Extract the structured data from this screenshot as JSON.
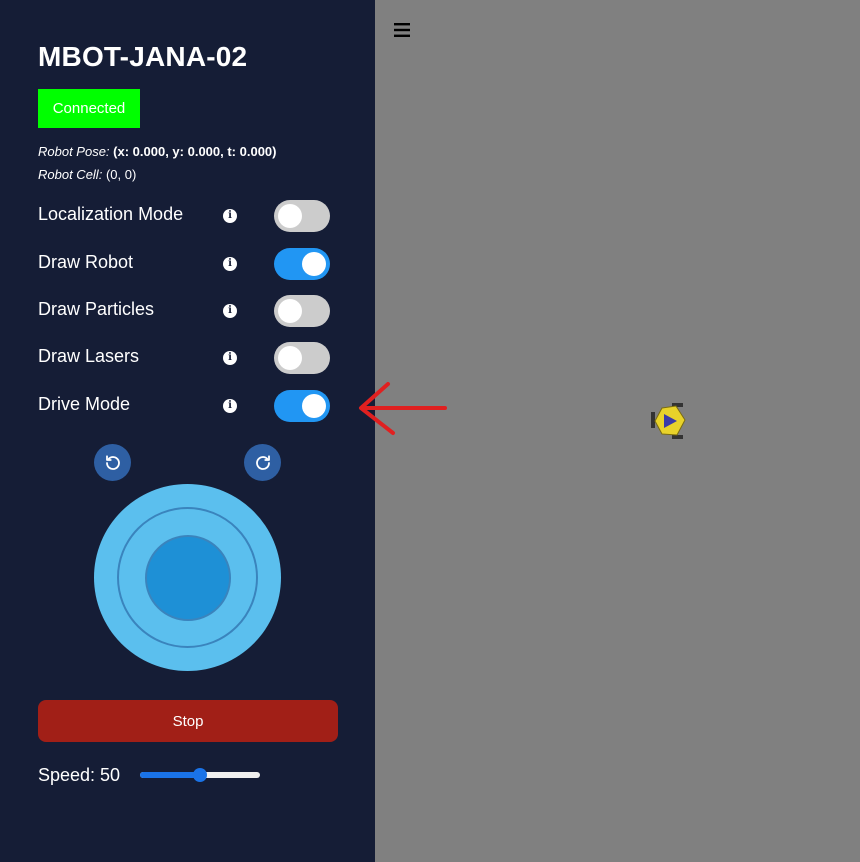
{
  "sidebar": {
    "title": "MBOT-JANA-02",
    "status_label": "Connected",
    "pose": {
      "pose_label": "Robot Pose:",
      "pose_value": "(x: 0.000, y: 0.000, t: 0.000)",
      "cell_label": "Robot Cell:",
      "cell_value": "(0, 0)"
    },
    "toggles": [
      {
        "label": "Localization Mode",
        "on": false
      },
      {
        "label": "Draw Robot",
        "on": true
      },
      {
        "label": "Draw Particles",
        "on": false
      },
      {
        "label": "Draw Lasers",
        "on": false
      },
      {
        "label": "Drive Mode",
        "on": true
      }
    ],
    "info_glyph": "i",
    "stop_label": "Stop",
    "speed": {
      "label": "Speed: 50",
      "value": 50,
      "min": 0,
      "max": 100
    }
  },
  "icons": {
    "menu": "hamburger-icon",
    "rotate_left": "rotate-ccw-icon",
    "rotate_right": "rotate-cw-icon",
    "robot": "robot-icon",
    "annotation": "red-arrow-icon"
  },
  "colors": {
    "sidebar_bg": "#151d36",
    "canvas_bg": "#808080",
    "status_bg": "#00ff00",
    "toggle_on": "#2196f3",
    "toggle_off": "#cccccc",
    "stop_bg": "#a11f17",
    "joystick_outer": "#5bbfee",
    "joystick_knob": "#1e90d6",
    "robot_yellow": "#e8d22a",
    "robot_triangle": "#3a3aa8",
    "annotation_red": "#e02020"
  }
}
